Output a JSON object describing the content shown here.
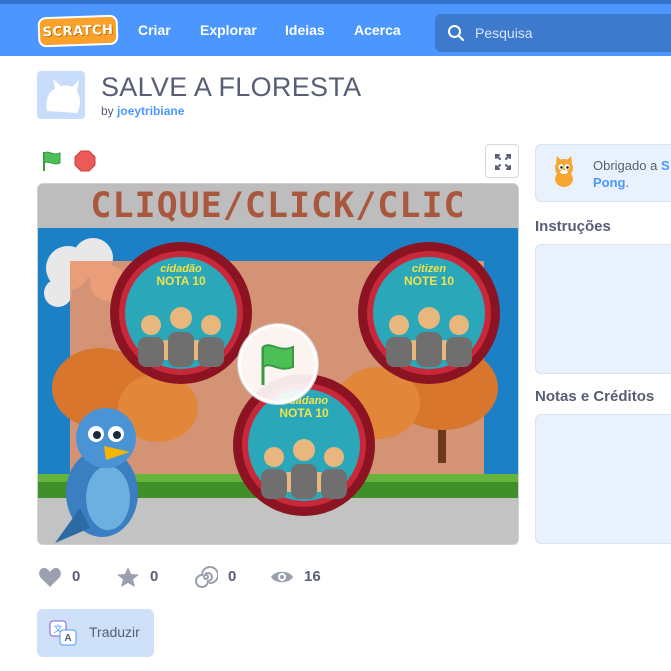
{
  "nav": {
    "logo": "SCRATCH",
    "items": [
      "Criar",
      "Explorar",
      "Ideias",
      "Acerca"
    ],
    "search_placeholder": "Pesquisa"
  },
  "project": {
    "title": "SALVE A FLORESTA",
    "by": "by",
    "author": "joeytribiane"
  },
  "stage": {
    "banner_text": "CLIQUE/CLICK/CLIC",
    "medallions": [
      {
        "line1": "cidadão",
        "line2": "NOTA 10"
      },
      {
        "line1": "citizen",
        "line2": "NOTE 10"
      },
      {
        "line1": "cidadano",
        "line2": "NOTA 10"
      }
    ]
  },
  "stats": {
    "loves": "0",
    "favorites": "0",
    "remixes": "0",
    "views": "16"
  },
  "translate_label": "Traduzir",
  "sidebar": {
    "remix_prefix": "Obrigado a",
    "remix_author": "S",
    "remix_project": "Pong",
    "remix_suffix": ".",
    "instructions_label": "Instruções",
    "notes_label": "Notas e Créditos"
  },
  "colors": {
    "nav_blue": "#4c97ff",
    "flag_green": "#4cbf56",
    "stop_red": "#ec5959",
    "banner_text": "#a9573d",
    "sky": "#1b80c6"
  }
}
